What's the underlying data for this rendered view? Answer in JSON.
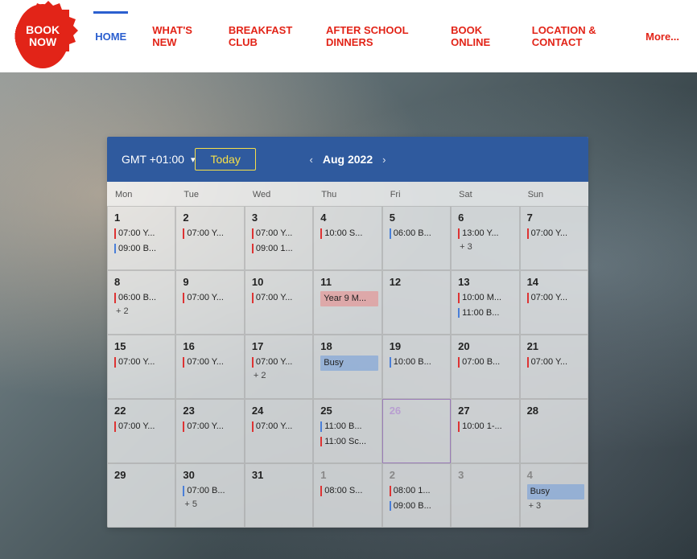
{
  "badge": {
    "line1": "BOOK",
    "line2": "NOW"
  },
  "nav": {
    "items": [
      {
        "label": "HOME",
        "active": true
      },
      {
        "label": "WHAT'S NEW",
        "active": false
      },
      {
        "label": "BREAKFAST CLUB",
        "active": false
      },
      {
        "label": "AFTER SCHOOL DINNERS",
        "active": false
      },
      {
        "label": "BOOK ONLINE",
        "active": false
      },
      {
        "label": "LOCATION & CONTACT",
        "active": false
      }
    ],
    "more": "More..."
  },
  "calendar": {
    "timezone": "GMT +01:00",
    "month_label": "Aug 2022",
    "today_label": "Today",
    "dow": [
      "Mon",
      "Tue",
      "Wed",
      "Thu",
      "Fri",
      "Sat",
      "Sun"
    ],
    "weeks": [
      [
        {
          "d": "1",
          "ev": [
            [
              "red",
              "07:00 Y..."
            ],
            [
              "blue",
              "09:00 B..."
            ]
          ]
        },
        {
          "d": "2",
          "ev": [
            [
              "red",
              "07:00 Y..."
            ]
          ]
        },
        {
          "d": "3",
          "ev": [
            [
              "red",
              "07:00 Y..."
            ],
            [
              "red",
              "09:00 1..."
            ]
          ]
        },
        {
          "d": "4",
          "ev": [
            [
              "red",
              "10:00 S..."
            ]
          ]
        },
        {
          "d": "5",
          "ev": [
            [
              "blue",
              "06:00 B..."
            ]
          ]
        },
        {
          "d": "6",
          "ev": [
            [
              "red",
              "13:00 Y..."
            ]
          ],
          "more": "+ 3"
        },
        {
          "d": "7",
          "ev": [
            [
              "red",
              "07:00 Y..."
            ]
          ]
        }
      ],
      [
        {
          "d": "8",
          "ev": [
            [
              "red",
              "06:00 B..."
            ]
          ],
          "more": "+ 2"
        },
        {
          "d": "9",
          "ev": [
            [
              "red",
              "07:00 Y..."
            ]
          ]
        },
        {
          "d": "10",
          "ev": [
            [
              "red",
              "07:00 Y..."
            ]
          ]
        },
        {
          "d": "11",
          "ev": [
            [
              "block pink",
              "Year 9 M..."
            ]
          ]
        },
        {
          "d": "12",
          "ev": []
        },
        {
          "d": "13",
          "ev": [
            [
              "red",
              "10:00 M..."
            ],
            [
              "blue",
              "11:00 B..."
            ]
          ]
        },
        {
          "d": "14",
          "ev": [
            [
              "red",
              "07:00 Y..."
            ]
          ]
        }
      ],
      [
        {
          "d": "15",
          "ev": [
            [
              "red",
              "07:00 Y..."
            ]
          ]
        },
        {
          "d": "16",
          "ev": [
            [
              "red",
              "07:00 Y..."
            ]
          ]
        },
        {
          "d": "17",
          "ev": [
            [
              "red",
              "07:00 Y..."
            ]
          ],
          "more": "+ 2"
        },
        {
          "d": "18",
          "ev": [
            [
              "block",
              "Busy"
            ]
          ]
        },
        {
          "d": "19",
          "ev": [
            [
              "blue",
              "10:00 B..."
            ]
          ]
        },
        {
          "d": "20",
          "ev": [
            [
              "red",
              "07:00 B..."
            ]
          ]
        },
        {
          "d": "21",
          "ev": [
            [
              "red",
              "07:00 Y..."
            ]
          ]
        }
      ],
      [
        {
          "d": "22",
          "ev": [
            [
              "red",
              "07:00 Y..."
            ]
          ]
        },
        {
          "d": "23",
          "ev": [
            [
              "red",
              "07:00 Y..."
            ]
          ]
        },
        {
          "d": "24",
          "ev": [
            [
              "red",
              "07:00 Y..."
            ]
          ]
        },
        {
          "d": "25",
          "ev": [
            [
              "blue",
              "11:00 B..."
            ],
            [
              "red",
              "11:00 Sc..."
            ]
          ]
        },
        {
          "d": "26",
          "ev": [],
          "today": true
        },
        {
          "d": "27",
          "ev": [
            [
              "red",
              "10:00 1-..."
            ]
          ]
        },
        {
          "d": "28",
          "ev": []
        }
      ],
      [
        {
          "d": "29",
          "ev": []
        },
        {
          "d": "30",
          "ev": [
            [
              "blue",
              "07:00 B..."
            ]
          ],
          "more": "+ 5"
        },
        {
          "d": "31",
          "ev": []
        },
        {
          "d": "1",
          "ev": [
            [
              "red",
              "08:00 S..."
            ]
          ],
          "muted": true
        },
        {
          "d": "2",
          "ev": [
            [
              "red",
              "08:00 1..."
            ],
            [
              "blue",
              "09:00 B..."
            ]
          ],
          "muted": true
        },
        {
          "d": "3",
          "ev": [],
          "muted": true
        },
        {
          "d": "4",
          "ev": [
            [
              "block",
              "Busy"
            ]
          ],
          "more": "+ 3",
          "muted": true
        }
      ]
    ]
  }
}
